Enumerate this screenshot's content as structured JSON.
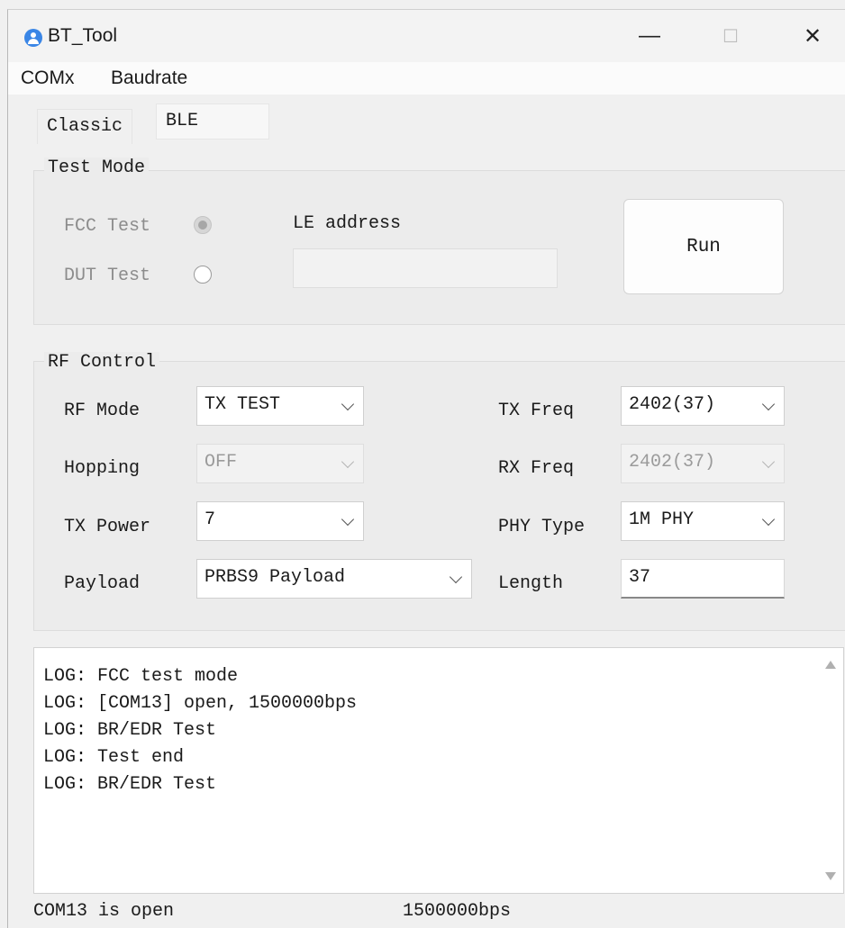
{
  "window": {
    "title": "BT_Tool",
    "controls": {
      "minimize": "—",
      "maximize": "☐",
      "close": "✕"
    }
  },
  "menu": {
    "items": [
      "COMx",
      "Baudrate"
    ]
  },
  "tabs": [
    {
      "label": "Classic",
      "active": true
    },
    {
      "label": "BLE",
      "active": false
    }
  ],
  "test_mode": {
    "group_label": "Test Mode",
    "fcc_label": "FCC Test",
    "fcc_checked": true,
    "dut_label": "DUT Test",
    "dut_checked": false,
    "le_address_label": "LE address",
    "le_address_value": "",
    "run_label": "Run"
  },
  "rf_control": {
    "group_label": "RF Control",
    "rf_mode": {
      "label": "RF Mode",
      "value": "TX TEST"
    },
    "hopping": {
      "label": "Hopping",
      "value": "OFF"
    },
    "tx_power": {
      "label": "TX Power",
      "value": "7"
    },
    "payload": {
      "label": "Payload",
      "value": "PRBS9 Payload"
    },
    "tx_freq": {
      "label": "TX Freq",
      "value": "2402(37)"
    },
    "rx_freq": {
      "label": "RX Freq",
      "value": "2402(37)"
    },
    "phy_type": {
      "label": "PHY Type",
      "value": "1M PHY"
    },
    "length": {
      "label": "Length",
      "value": "37"
    }
  },
  "log": {
    "lines": [
      "LOG: FCC test mode",
      "LOG: [COM13] open, 1500000bps",
      "LOG: BR/EDR Test",
      "LOG: Test end",
      "LOG: BR/EDR Test"
    ]
  },
  "status": {
    "port": "COM13 is open",
    "baud": "1500000bps"
  }
}
